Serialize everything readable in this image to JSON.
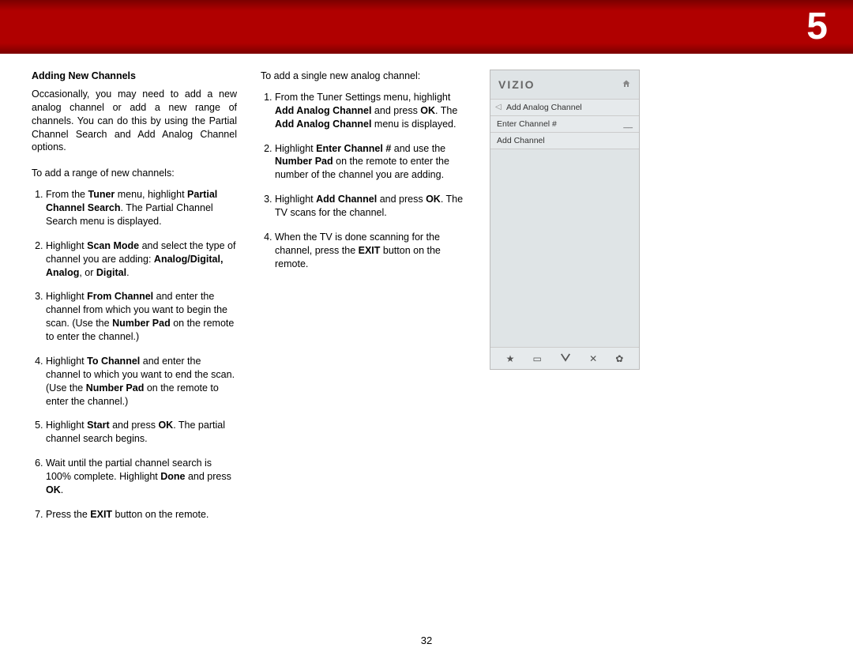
{
  "chapter": "5",
  "pageNumber": "32",
  "left": {
    "heading": "Adding New Channels",
    "intro": "Occasionally, you may need to add a new analog channel or add a new range of channels. You can do this by using the Partial Channel Search and Add Analog Channel options.",
    "lead": "To add a range of new channels:",
    "s1a": "From the ",
    "s1b": "Tuner",
    "s1c": " menu, highlight ",
    "s1d": "Partial Channel Search",
    "s1e": ". The Partial Channel Search menu is displayed.",
    "s2a": "Highlight ",
    "s2b": "Scan Mode",
    "s2c": " and select the type of channel you are adding: ",
    "s2d": "Analog/Digital, Analog",
    "s2e": ", or ",
    "s2f": "Digital",
    "s2g": ".",
    "s3a": "Highlight ",
    "s3b": "From Channel",
    "s3c": " and enter the channel from which you want to begin the scan. (Use the ",
    "s3d": "Number Pad",
    "s3e": " on the remote to enter the channel.)",
    "s4a": "Highlight ",
    "s4b": "To Channel",
    "s4c": " and enter the channel to which you want to end the scan. (Use the ",
    "s4d": "Number Pad",
    "s4e": " on the remote to enter the channel.)",
    "s5a": "Highlight ",
    "s5b": "Start",
    "s5c": " and press ",
    "s5d": "OK",
    "s5e": ". The partial channel search begins.",
    "s6a": "Wait until the partial channel search is 100% complete. Highlight ",
    "s6b": "Done",
    "s6c": " and press ",
    "s6d": "OK",
    "s6e": ".",
    "s7a": "Press the ",
    "s7b": "EXIT",
    "s7c": " button on the remote."
  },
  "mid": {
    "lead": "To add a single new analog channel:",
    "s1a": "From the Tuner Settings menu, highlight ",
    "s1b": "Add Analog Channel",
    "s1c": " and press ",
    "s1d": "OK",
    "s1e": ". The ",
    "s1f": "Add Analog Channel",
    "s1g": " menu is displayed.",
    "s2a": "Highlight ",
    "s2b": "Enter Channel #",
    "s2c": " and use the ",
    "s2d": "Number Pad",
    "s2e": " on the remote to enter the number of the channel you are adding.",
    "s3a": "Highlight ",
    "s3b": "Add Channel",
    "s3c": " and press ",
    "s3d": "OK",
    "s3e": ". The TV scans for the channel.",
    "s4a": "When the TV is done scanning for the channel, press the ",
    "s4b": "EXIT",
    "s4c": " button on the remote."
  },
  "tv": {
    "logo": "VIZIO",
    "row1": "Add Analog Channel",
    "row2label": "Enter Channel #",
    "row2value": "__",
    "row3": "Add Channel"
  }
}
